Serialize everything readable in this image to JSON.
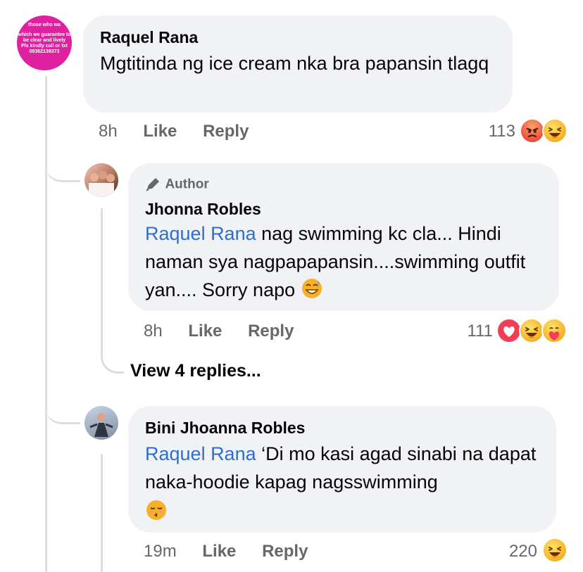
{
  "comment1": {
    "avatar_lines": [
      "those who wa",
      "which we guarantee to",
      "be clear and lively",
      "Pls kindly call or txt",
      "09362139373"
    ],
    "author": "Raquel Rana",
    "text": "Mgtitinda ng ice cream nka  bra papansin tlagq",
    "time": "8h",
    "like": "Like",
    "reply": "Reply",
    "reaction_count": "113",
    "reactions": [
      "angry-icon",
      "haha-icon"
    ]
  },
  "reply1": {
    "badge": "Author",
    "author": "Jhonna Robles",
    "mention": "Raquel Rana",
    "text": " nag swimming kc cla... Hindi naman sya nagpapapansin....swimming outfit yan.... Sorry napo",
    "emoji": "sweat-smile-emoji",
    "time": "8h",
    "like": "Like",
    "reply": "Reply",
    "reaction_count": "111",
    "reactions": [
      "love-icon",
      "haha-icon",
      "care-icon"
    ]
  },
  "view_replies": "View 4 replies...",
  "reply2": {
    "author": "Bini Jhoanna Robles",
    "mention": "Raquel Rana",
    "text": " ‘Di mo kasi agad sinabi na dapat naka-hoodie kapag nagsswimming",
    "emoji": "kissing-emoji",
    "time": "19m",
    "like": "Like",
    "reply": "Reply",
    "reaction_count": "220",
    "reactions": [
      "haha-icon"
    ]
  },
  "colors": {
    "bubble": "#f0f2f5",
    "mention": "#2d6fce",
    "meta": "#65676b",
    "line": "#dadde1",
    "avatar_magenta": "#e0219f"
  }
}
